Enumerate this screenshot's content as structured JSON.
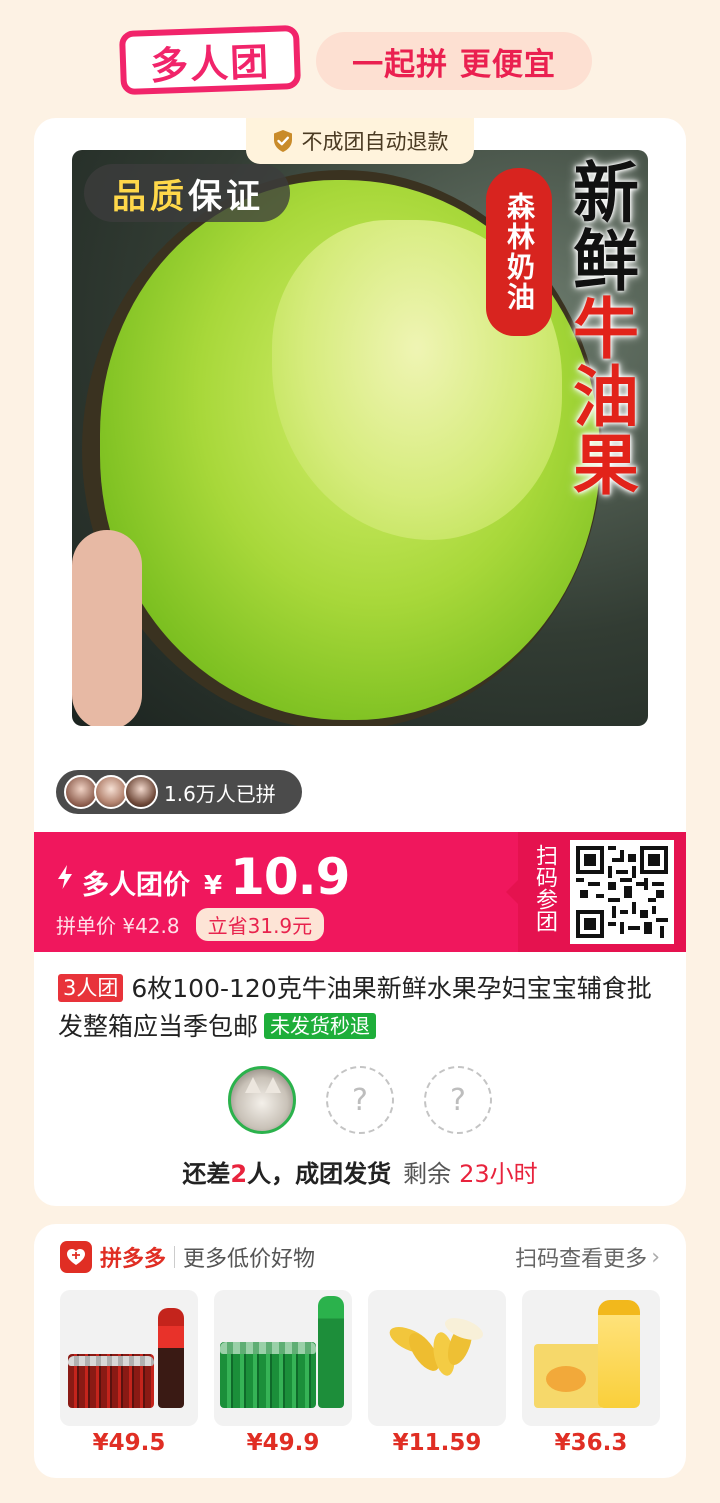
{
  "header": {
    "logo_text": "多人团",
    "slogan": "一起拼 更便宜"
  },
  "product": {
    "refund_tag": "不成团自动退款",
    "image": {
      "quality_badge": [
        "品",
        "质",
        "保",
        "证"
      ],
      "seal_text": "森林奶油",
      "vertical_title_black": "新鲜",
      "vertical_title_red": "牛油果"
    },
    "joined_count": "1.6万人已拼",
    "price": {
      "label": "多人团价",
      "currency": "¥",
      "value": "10.9",
      "single_price": "拼单价 ¥42.8",
      "save_badge": "立省31.9元",
      "scan_label": "扫码参团"
    },
    "group_tag": "3人团",
    "title": "6枚100-120克牛油果新鲜水果孕妇宝宝辅食批发整箱应当季包邮",
    "ship_tag": "未发货秒退",
    "members": {
      "slot_mark": "?",
      "status_prefix": "还差",
      "status_count": "2",
      "status_suffix": "人，成团发货",
      "remain_label": "剩余",
      "remain_time": "23小时"
    }
  },
  "more": {
    "brand": "拼多多",
    "subtitle": "更多低价好物",
    "link": "扫码查看更多",
    "items": [
      {
        "price": "¥49.5"
      },
      {
        "price": "¥49.9"
      },
      {
        "price": "¥11.59"
      },
      {
        "price": "¥36.3"
      }
    ]
  },
  "colors": {
    "accent_pink": "#f0175d",
    "pdd_red": "#e02e24",
    "ship_green": "#1eae3a",
    "background": "#fdf2e4"
  }
}
